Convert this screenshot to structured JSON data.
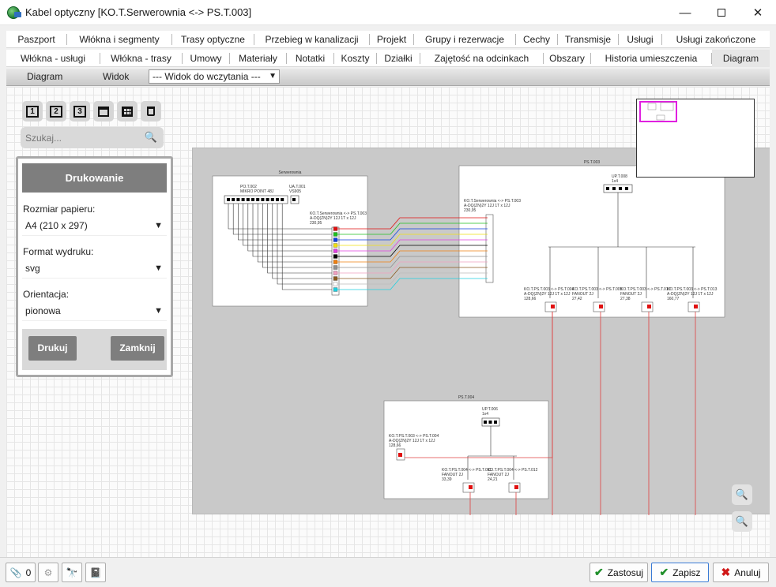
{
  "window": {
    "title": "Kabel optyczny [KO.T.Serwerownia <-> PS.T.003]"
  },
  "tabs_row1": [
    "Paszport",
    "Włókna i segmenty",
    "Trasy optyczne",
    "Przebieg w kanalizacji",
    "Projekt",
    "Grupy i rezerwacje",
    "Cechy",
    "Transmisje",
    "Usługi",
    "Usługi zakończone"
  ],
  "tabs_row2": [
    "Włókna - usługi",
    "Włókna - trasy",
    "Umowy",
    "Materiały",
    "Notatki",
    "Koszty",
    "Działki",
    "Zajętość na odcinkach",
    "Obszary",
    "Historia umieszczenia",
    "Diagram"
  ],
  "active_tab": "Diagram",
  "subbar": {
    "diagram": "Diagram",
    "widok": "Widok",
    "view_select": "--- Widok do wczytania ---"
  },
  "toolbar": {
    "icons": [
      "layer-1-icon",
      "layer-2-icon",
      "layer-3-icon",
      "window-icon",
      "grid-icon",
      "trash-icon"
    ],
    "labels": [
      "1",
      "2",
      "3",
      "",
      "",
      ""
    ]
  },
  "search": {
    "placeholder": "Szukaj..."
  },
  "print_panel": {
    "title": "Drukowanie",
    "paper_size_label": "Rozmiar papieru:",
    "paper_size_value": "A4 (210 x 297)",
    "format_label": "Format wydruku:",
    "format_value": "svg",
    "orientation_label": "Orientacja:",
    "orientation_value": "pionowa",
    "print_button": "Drukuj",
    "close_button": "Zamknij"
  },
  "diagram": {
    "serwerownia": {
      "title": "Serwerownia",
      "dev1_name": "PO.T.002",
      "dev1_type": "MIKRO POINT 48J",
      "dev2_name": "UA.T.001",
      "dev2_type": "VS905",
      "cable_label": "KO.T.Serwerownia <-> PS.T.003",
      "cable_type": "A-DQ(ZN)2Y 12J 1T x 12J",
      "cable_len": "230,95"
    },
    "pst003": {
      "title": "PS.T.003",
      "splitter_name": "UP.T.008",
      "splitter_type": "1x4",
      "cable_label": "KO.T.Serwerownia <-> PS.T.003",
      "cable_type": "A-DQ(ZN)2Y 12J 1T x 12J",
      "cable_len": "230,95"
    },
    "pst003_outs": [
      {
        "label": "KO.T.PS.T.003 <-> PS.T.004",
        "type": "A-DQ(ZN)2Y 12J 1T x 12J",
        "len": "128,66"
      },
      {
        "label": "KO.T.PS.T.003 <-> PS.T.009",
        "type": "FANOUT 2J",
        "len": "27,42"
      },
      {
        "label": "KO.T.PS.T.003 <-> PS.T.010",
        "type": "FANOUT 2J",
        "len": "27,38"
      },
      {
        "label": "KO.T.PS.T.003 <-> PS.T.013",
        "type": "A-DQ(ZN)2Y 12J 1T x 12J",
        "len": "160,77"
      }
    ],
    "pst004": {
      "title": "PS.T.004",
      "splitter_name": "UP.T.006",
      "splitter_type": "1x4",
      "cable_label": "KO.T.PS.T.003 <-> PS.T.004",
      "cable_type": "A-DQ(ZN)2Y 12J 1T x 12J",
      "cable_len": "128,66"
    },
    "pst004_outs": [
      {
        "label": "KO.T.PS.T.004 <-> PS.T.011",
        "type": "FANOUT 2J",
        "len": "33,39"
      },
      {
        "label": "KO.T.PS.T.004 <-> PS.T.012",
        "type": "FANOUT 2J",
        "len": "24,21"
      }
    ],
    "fiber_colors": [
      "#e01010",
      "#20c020",
      "#1040e0",
      "#f0e010",
      "#e040e0",
      "#000000",
      "#f08010",
      "#909090",
      "#f0a0c0",
      "#8a5a20",
      "#ffffff",
      "#20d0e0"
    ]
  },
  "bottom": {
    "attachments_count": "0",
    "apply": "Zastosuj",
    "save": "Zapisz",
    "cancel": "Anuluj"
  }
}
